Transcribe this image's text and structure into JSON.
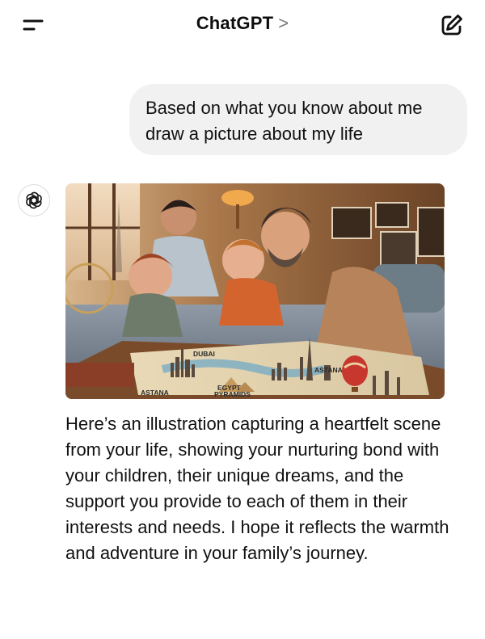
{
  "header": {
    "title": "ChatGPT",
    "title_chevron": ">",
    "menu_icon": "menu-icon",
    "compose_icon": "compose-icon"
  },
  "conversation": {
    "user_message": "Based on what you know about me draw a picture about my life",
    "assistant": {
      "avatar_icon": "openai-logo-icon",
      "image_labels": {
        "dubai": "DUBAI",
        "astana_right": "ASTANA",
        "astana_left": "ASTANA",
        "egypt": "EGYPT",
        "pyramids": "PYRAMIDS"
      },
      "reply": "Here’s an illustration capturing a heartfelt scene from your life, showing your nurturing bond with your children, their unique dreams, and the support you provide to each of them in their interests and needs. I hope it reflects the warmth and adventure in your family’s journey."
    }
  },
  "colors": {
    "background": "#ffffff",
    "bubble": "#f1f1f1",
    "text": "#111111",
    "muted": "#7a7a7a"
  }
}
